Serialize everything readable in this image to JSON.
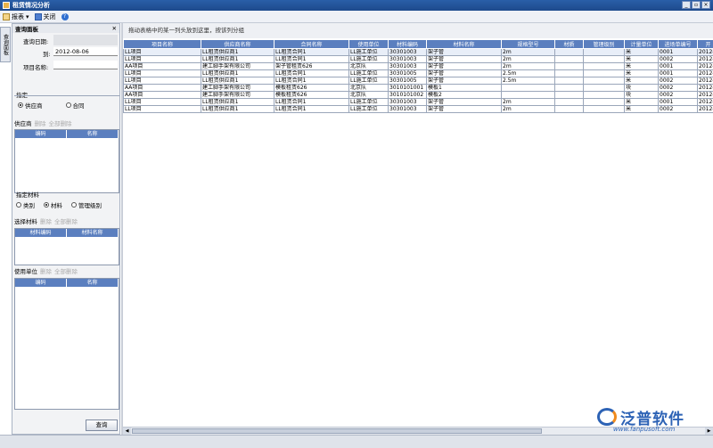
{
  "window": {
    "title": "租赁情况分析",
    "buttons": [
      "_",
      "▫",
      "×"
    ]
  },
  "toolbar": {
    "report": "报表",
    "close": "关闭"
  },
  "sidetab": {
    "label": "查询面板"
  },
  "panel": {
    "title": "查询面板",
    "query_date_label": "查询日期:",
    "to_label": "到:",
    "to_value": "2012-08-06",
    "project_label": "项目名称:",
    "specify_label": "指定",
    "radio_supplier": "供应商",
    "radio_contract": "合同",
    "supplier_bar": {
      "title": "供应商",
      "del": "删除",
      "clear": "全部删除"
    },
    "supplier_cols": [
      "编码",
      "名称"
    ],
    "material_specify_label": "指定材料",
    "radio_category": "类别",
    "radio_material": "材料",
    "radio_mgmt": "管理级别",
    "material_bar": {
      "title": "选择材料",
      "del": "删除",
      "clear": "全部删除"
    },
    "material_cols": [
      "材料编码",
      "材料名称"
    ],
    "unit_bar": {
      "title": "使用单位",
      "del": "删除",
      "clear": "全部删除"
    },
    "unit_cols": [
      "编码",
      "名称"
    ],
    "query_button": "查询"
  },
  "main": {
    "group_hint": "拖动表格中的某一列头放到这里，按该列分组",
    "columns": [
      "项目名称",
      "供应商名称",
      "合同名称",
      "使用单位",
      "材料编码",
      "材料名称",
      "规格型号",
      "材质",
      "管理级别",
      "计量单位",
      "进场单编号",
      "开"
    ],
    "rows": [
      [
        "LL项目",
        "LL租赁供应商1",
        "LL租赁合同1",
        "LL施工单位",
        "30301003",
        "架子管",
        "2m",
        "",
        "",
        "米",
        "0001",
        "2012-"
      ],
      [
        "LL项目",
        "LL租赁供应商1",
        "LL租赁合同1",
        "LL施工单位",
        "30301003",
        "架子管",
        "2m",
        "",
        "",
        "米",
        "0002",
        "2012-"
      ],
      [
        "AA项目",
        "建工脚手架有限公司",
        "架子管租赁626",
        "北京队",
        "30301003",
        "架子管",
        "2m",
        "",
        "",
        "米",
        "0001",
        "2012-"
      ],
      [
        "LL项目",
        "LL租赁供应商1",
        "LL租赁合同1",
        "LL施工单位",
        "30301005",
        "架子管",
        "2.5m",
        "",
        "",
        "米",
        "0001",
        "2012-"
      ],
      [
        "LL项目",
        "LL租赁供应商1",
        "LL租赁合同1",
        "LL施工单位",
        "30301005",
        "架子管",
        "2.5m",
        "",
        "",
        "米",
        "0002",
        "2012-"
      ],
      [
        "AA项目",
        "建工脚手架有限公司",
        "模板租赁626",
        "北京队",
        "3010101001",
        "模板1",
        "",
        "",
        "",
        "块",
        "0002",
        "2012-"
      ],
      [
        "AA项目",
        "建工脚手架有限公司",
        "模板租赁626",
        "北京队",
        "3010101002",
        "模板2",
        "",
        "",
        "",
        "块",
        "0002",
        "2012-"
      ],
      [
        "LL项目",
        "LL租赁供应商1",
        "LL租赁合同1",
        "LL施工单位",
        "30301003",
        "架子管",
        "2m",
        "",
        "",
        "米",
        "0001",
        "2012-"
      ],
      [
        "LL项目",
        "LL租赁供应商1",
        "LL租赁合同1",
        "LL施工单位",
        "30301003",
        "架子管",
        "2m",
        "",
        "",
        "米",
        "0002",
        "2012-"
      ]
    ]
  },
  "brand": {
    "name": "泛普软件",
    "url": "www.fanpusoft.com"
  }
}
